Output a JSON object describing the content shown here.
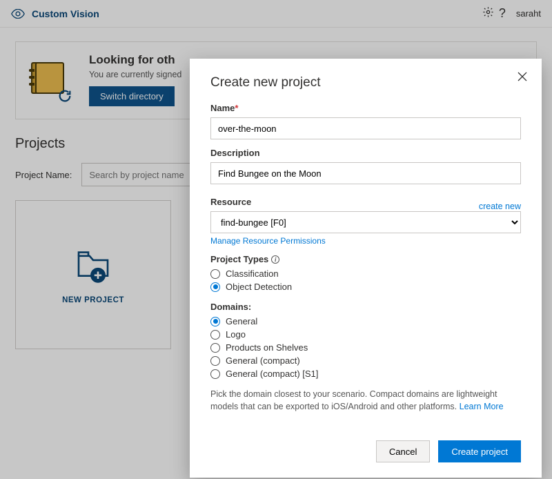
{
  "header": {
    "brand": "Custom Vision",
    "username": "saraht"
  },
  "banner": {
    "title": "Looking for oth",
    "subtitle": "You are currently signed",
    "button": "Switch directory"
  },
  "projects": {
    "heading": "Projects",
    "filter_label": "Project Name:",
    "filter_placeholder": "Search by project name",
    "new_project_caption": "NEW PROJECT"
  },
  "dialog": {
    "title": "Create new project",
    "name_label": "Name",
    "name_value": "over-the-moon",
    "desc_label": "Description",
    "desc_value": "Find Bungee on the Moon",
    "resource_label": "Resource",
    "resource_create_new": "create new",
    "resource_value": "find-bungee [F0]",
    "manage_permissions": "Manage Resource Permissions",
    "project_types_label": "Project Types",
    "project_types": [
      {
        "label": "Classification",
        "selected": false
      },
      {
        "label": "Object Detection",
        "selected": true
      }
    ],
    "domains_label": "Domains:",
    "domains": [
      {
        "label": "General",
        "selected": true
      },
      {
        "label": "Logo",
        "selected": false
      },
      {
        "label": "Products on Shelves",
        "selected": false
      },
      {
        "label": "General (compact)",
        "selected": false
      },
      {
        "label": "General (compact) [S1]",
        "selected": false
      }
    ],
    "helper_text": "Pick the domain closest to your scenario. Compact domains are lightweight models that can be exported to iOS/Android and other platforms. ",
    "learn_more": "Learn More",
    "cancel": "Cancel",
    "create": "Create project"
  }
}
